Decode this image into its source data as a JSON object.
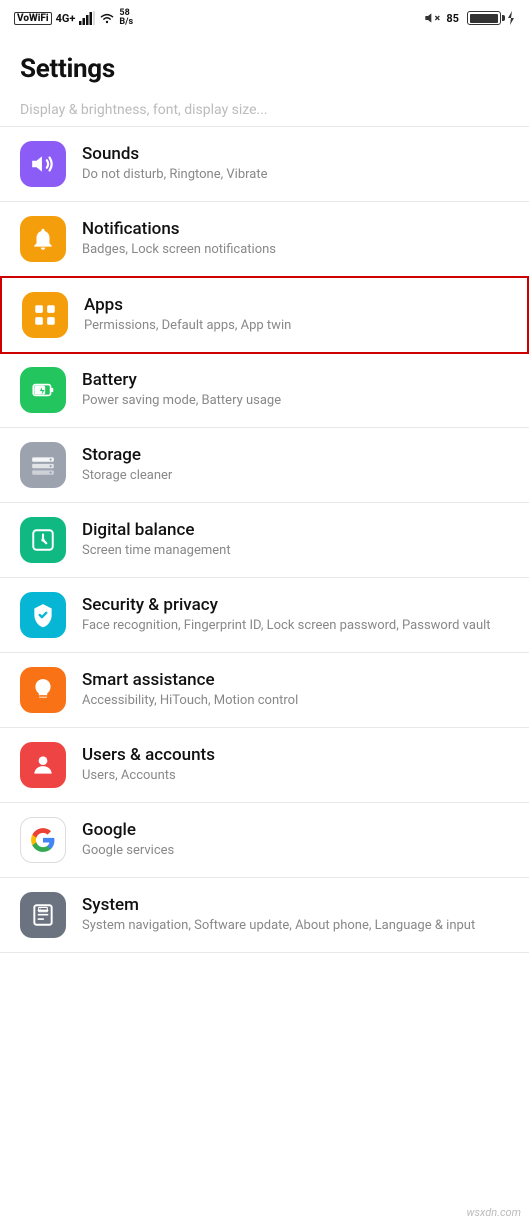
{
  "statusBar": {
    "leftItems": [
      "VoWiFi",
      "4G+",
      "signal",
      "wifi",
      "58 B/s"
    ],
    "battery": "85",
    "charging": true,
    "mute": true
  },
  "pageTitle": "Settings",
  "partialItem": "... Display & brightness, font, display size...",
  "settingsItems": [
    {
      "id": "sounds",
      "title": "Sounds",
      "subtitle": "Do not disturb, Ringtone, Vibrate",
      "iconColor": "icon-sounds",
      "highlighted": false
    },
    {
      "id": "notifications",
      "title": "Notifications",
      "subtitle": "Badges, Lock screen notifications",
      "iconColor": "icon-notifications",
      "highlighted": false
    },
    {
      "id": "apps",
      "title": "Apps",
      "subtitle": "Permissions, Default apps, App twin",
      "iconColor": "icon-apps",
      "highlighted": true
    },
    {
      "id": "battery",
      "title": "Battery",
      "subtitle": "Power saving mode, Battery usage",
      "iconColor": "icon-battery",
      "highlighted": false
    },
    {
      "id": "storage",
      "title": "Storage",
      "subtitle": "Storage cleaner",
      "iconColor": "icon-storage",
      "highlighted": false
    },
    {
      "id": "digital-balance",
      "title": "Digital balance",
      "subtitle": "Screen time management",
      "iconColor": "icon-digital-balance",
      "highlighted": false
    },
    {
      "id": "security",
      "title": "Security & privacy",
      "subtitle": "Face recognition, Fingerprint ID, Lock screen password, Password vault",
      "iconColor": "icon-security",
      "highlighted": false
    },
    {
      "id": "smart-assistance",
      "title": "Smart assistance",
      "subtitle": "Accessibility, HiTouch, Motion control",
      "iconColor": "icon-smart-assistance",
      "highlighted": false
    },
    {
      "id": "users",
      "title": "Users & accounts",
      "subtitle": "Users, Accounts",
      "iconColor": "icon-users",
      "highlighted": false
    },
    {
      "id": "google",
      "title": "Google",
      "subtitle": "Google services",
      "iconColor": "icon-google",
      "highlighted": false
    },
    {
      "id": "system",
      "title": "System",
      "subtitle": "System navigation, Software update, About phone, Language & input",
      "iconColor": "icon-system",
      "highlighted": false
    }
  ],
  "watermark": "wsxdn.com"
}
